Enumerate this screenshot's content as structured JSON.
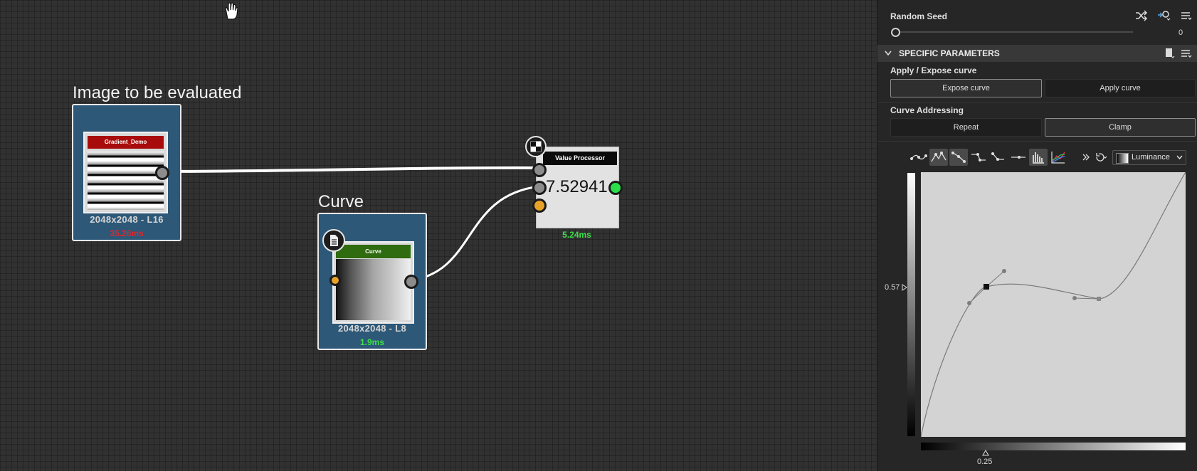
{
  "graph": {
    "frames": [
      {
        "title": "Image to be evaluated"
      },
      {
        "title": "Curve"
      }
    ],
    "nodes": {
      "gradient": {
        "label": "Gradient_Demo",
        "resolution": "2048x2048 - L16",
        "time": "35.26ms",
        "time_color": "#e0262c"
      },
      "curve": {
        "label": "Curve",
        "resolution": "2048x2048 - L8",
        "time": "1.9ms",
        "time_color": "#3de048"
      },
      "value_processor": {
        "label": "Value Processor",
        "value": "7.52941",
        "time": "5.24ms",
        "time_color": "#3de048"
      }
    }
  },
  "panel": {
    "random_seed": {
      "label": "Random Seed",
      "value": "0",
      "slider_fraction": 0
    },
    "section": {
      "title": "SPECIFIC PARAMETERS"
    },
    "apply_expose": {
      "label": "Apply / Expose curve",
      "buttons": [
        "Expose curve",
        "Apply curve"
      ],
      "selected": "Expose curve"
    },
    "addressing": {
      "label": "Curve Addressing",
      "buttons": [
        "Repeat",
        "Clamp"
      ],
      "selected": "Clamp"
    },
    "curve_editor": {
      "channel": "Luminance",
      "y_marker": "0.57",
      "x_marker": "0.25",
      "toolbar_icons": [
        "curve-tool-1-icon",
        "curve-tool-2-icon",
        "curve-tool-3-icon",
        "curve-tool-4-icon",
        "curve-tool-5-icon",
        "curve-tool-6-icon",
        "histogram-icon",
        "channels-icon",
        "expand-icon",
        "reset-icon"
      ]
    }
  },
  "colors": {
    "node_blue": "#2d5878",
    "gradient_header": "#a80b0b",
    "curve_header": "#2f6b0f",
    "port_orange": "#e8a22a",
    "port_green": "#29e04a"
  }
}
